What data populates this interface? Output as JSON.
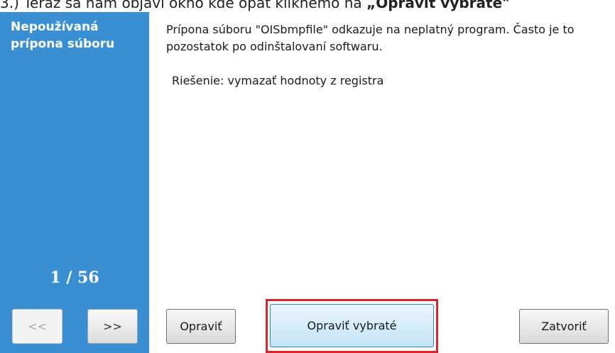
{
  "caption": {
    "text": "3.) Teraz sa nám objaví okno kde opäť kliknemo na ",
    "bold": "„Opraviť vybraté\""
  },
  "sidebar": {
    "title": "Nepoužívaná prípona súboru",
    "counter": "1 / 56",
    "prev_label": "<<",
    "next_label": ">>"
  },
  "content": {
    "description": "Prípona súboru \"OISbmpfile\" odkazuje na neplatný program. Často je to pozostatok po odinštalovaní softwaru.",
    "solution": "Riešenie: vymazať hodnoty z registra"
  },
  "buttons": {
    "fix": "Opraviť",
    "fix_selected": "Opraviť vybraté",
    "close": "Zatvoriť"
  },
  "colors": {
    "sidebar": "#3a8fd3",
    "highlight": "#d8252f"
  }
}
